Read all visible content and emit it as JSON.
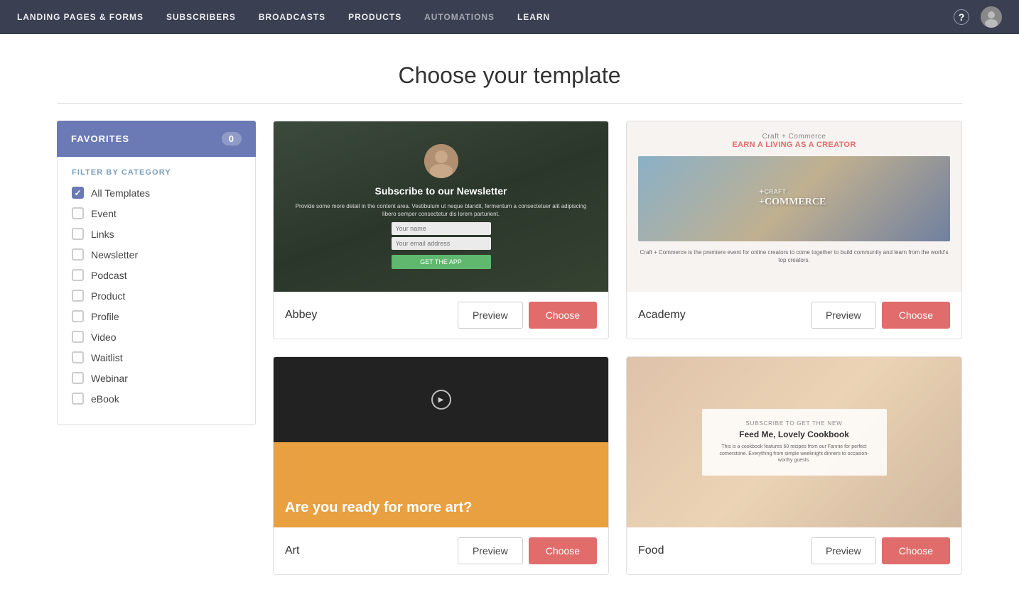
{
  "nav": {
    "items": [
      {
        "label": "Landing Pages & Forms",
        "muted": false
      },
      {
        "label": "Subscribers",
        "muted": false
      },
      {
        "label": "Broadcasts",
        "muted": false
      },
      {
        "label": "Products",
        "muted": false
      },
      {
        "label": "Automations",
        "muted": true
      },
      {
        "label": "Learn",
        "muted": false
      }
    ],
    "help_label": "?",
    "avatar_label": "User Avatar"
  },
  "page": {
    "title": "Choose your template"
  },
  "sidebar": {
    "favorites_label": "FAVORITES",
    "favorites_count": "0",
    "filter_title": "FILTER BY CATEGORY",
    "categories": [
      {
        "label": "All Templates",
        "checked": true
      },
      {
        "label": "Event",
        "checked": false
      },
      {
        "label": "Links",
        "checked": false
      },
      {
        "label": "Newsletter",
        "checked": false
      },
      {
        "label": "Podcast",
        "checked": false
      },
      {
        "label": "Product",
        "checked": false
      },
      {
        "label": "Profile",
        "checked": false
      },
      {
        "label": "Video",
        "checked": false
      },
      {
        "label": "Waitlist",
        "checked": false
      },
      {
        "label": "Webinar",
        "checked": false
      },
      {
        "label": "eBook",
        "checked": false
      }
    ]
  },
  "templates": [
    {
      "name": "Abbey",
      "preview_type": "abbey",
      "preview_label": "Preview",
      "choose_label": "Choose"
    },
    {
      "name": "Academy",
      "preview_type": "academy",
      "preview_label": "Preview",
      "choose_label": "Choose"
    },
    {
      "name": "Art",
      "preview_type": "art",
      "preview_label": "Preview",
      "choose_label": "Choose"
    },
    {
      "name": "Food",
      "preview_type": "food",
      "preview_label": "Preview",
      "choose_label": "Choose"
    }
  ],
  "abbey_preview": {
    "headline": "Subscribe to our Newsletter",
    "body": "Provide some more detail in the content area. Vestibulum ut neque blandit, fermentum a consectetuer alit adipiscing libero semper consectetur dis lorem parturient.",
    "input1_placeholder": "Your name",
    "input2_placeholder": "Your email address",
    "button_label": "GET THE APP"
  },
  "academy_preview": {
    "craft_label": "Craft + Commerce",
    "earn_label": "EARN A LIVING AS A CREATOR",
    "logo_label": "CRAFT + COMMERCE",
    "body": "Craft + Commerce is the premiere event for online creators to come together to build community and learn from the world's top creators."
  },
  "art_preview": {
    "headline": "Are you ready for more art?"
  },
  "food_preview": {
    "subtitle": "SUBSCRIBE TO GET THE NEW",
    "title": "Feed Me, Lovely Cookbook",
    "body": "This is a cookbook features 60 recipes from our Fannie for perfect cornerstone. Everything from simple weeknight dinners to occasion-worthy guests."
  }
}
